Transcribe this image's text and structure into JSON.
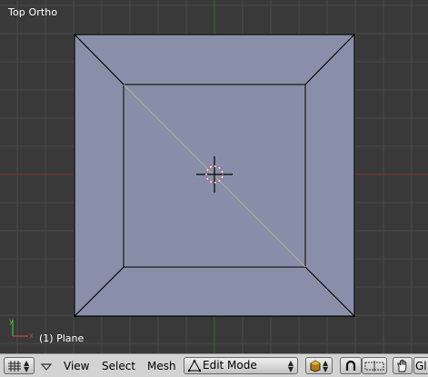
{
  "viewport": {
    "title": "Top Ortho",
    "object_info": "(1) Plane",
    "colors": {
      "background": "#393939",
      "grid": "#4a4a4a",
      "x_axis": "#8b2a2a",
      "y_axis": "#2f6b2f",
      "face": "#8a90a8",
      "edge": "#000000",
      "seam": "#a8b88a",
      "cursor_ring": "#e24a6a"
    }
  },
  "header": {
    "window_type_icon": "grid-icon",
    "collapse_icon": "triangle-down-icon",
    "menus": [
      "View",
      "Select",
      "Mesh"
    ],
    "mode": {
      "label": "Edit Mode",
      "icon": "edit-mode-triangle-icon"
    },
    "shading_icon": "solid-shading-icon",
    "pivot_icon": "magnet-icon",
    "manipulator_icon": "manipulator-icon",
    "hand_icon": "hand-icon",
    "truncated_label": "Gl"
  }
}
